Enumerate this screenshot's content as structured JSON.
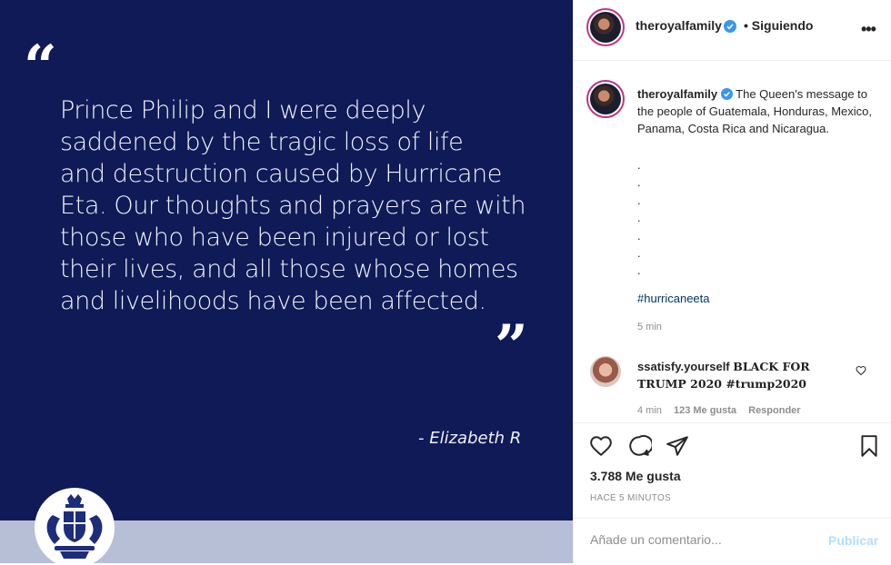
{
  "post": {
    "open_quote": "“",
    "quote_lines": [
      "Prince Philip and I were deeply",
      "saddened by the tragic loss of life",
      "and destruction caused by Hurricane",
      "Eta. Our thoughts and prayers are with",
      "those who have been injured or lost",
      "their lives, and all those whose homes",
      "and livelihoods have been affected."
    ],
    "close_quote": "”",
    "signature": "- Elizabeth R",
    "crest_icon": "royal-coat-of-arms"
  },
  "header": {
    "username": "theroyalfamily",
    "follow_status": "• Siguiendo",
    "more_icon": "more-options-icon"
  },
  "caption": {
    "username": "theroyalfamily",
    "text": "The Queen's message to the people of Guatemala, Honduras, Mexico, Panama, Costa Rica and Nicaragua.",
    "dots": [
      ".",
      ".",
      ".",
      ".",
      ".",
      ".",
      "."
    ],
    "hashtag": "#hurricaneeta",
    "time": "5 min"
  },
  "comment": {
    "username": "ssatisfy.yourself",
    "text": "𝐁𝐋𝐀𝐂𝐊 𝐅𝐎𝐑 𝐓𝐑𝐔𝐌𝐏 𝟐𝟎𝟐𝟎 #𝐭𝐫𝐮𝐦𝐩𝟐𝟎𝟐𝟎",
    "time": "4 min",
    "likes": "123 Me gusta",
    "reply": "Responder"
  },
  "actions": {
    "likes": "3.788 Me gusta",
    "posted": "HACE 5 MINUTOS"
  },
  "comment_box": {
    "placeholder": "Añade un comentario...",
    "publish": "Publicar"
  },
  "colors": {
    "image_background": "#0f1a57",
    "verified": "#3897f0",
    "link": "#00376b",
    "publish_disabled": "#b2dffc"
  }
}
